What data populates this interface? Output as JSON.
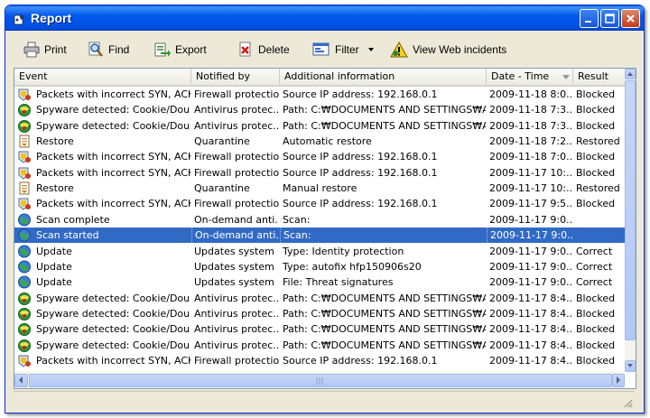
{
  "window": {
    "title": "Report"
  },
  "toolbar": {
    "print": "Print",
    "find": "Find",
    "export": "Export",
    "delete": "Delete",
    "filter": "Filter",
    "view_web": "View Web incidents"
  },
  "columns": [
    "Event",
    "Notified by",
    "Additional information",
    "Date - Time",
    "Result"
  ],
  "rows": [
    {
      "icon": "shield",
      "event": "Packets with incorrect SYN, ACK...",
      "notified": "Firewall protection",
      "info": "Source IP address: 192.168.0.1",
      "date": "2009-11-18 8:0...",
      "result": "Blocked"
    },
    {
      "icon": "spyware",
      "event": "Spyware detected: Cookie/Dou...",
      "notified": "Antivirus protec...",
      "info": "Path: C:₩DOCUMENTS AND SETTINGS₩AD...",
      "date": "2009-11-18 7:3...",
      "result": "Blocked"
    },
    {
      "icon": "spyware",
      "event": "Spyware detected: Cookie/Dou...",
      "notified": "Antivirus protec...",
      "info": "Path: C:₩DOCUMENTS AND SETTINGS₩AD...",
      "date": "2009-11-18 7:3...",
      "result": "Blocked"
    },
    {
      "icon": "restore",
      "event": "Restore",
      "notified": "Quarantine",
      "info": "Automatic restore",
      "date": "2009-11-18 7:2...",
      "result": "Restored"
    },
    {
      "icon": "shield",
      "event": "Packets with incorrect SYN, ACK...",
      "notified": "Firewall protection",
      "info": "Source IP address: 192.168.0.1",
      "date": "2009-11-18 7:0...",
      "result": "Blocked"
    },
    {
      "icon": "shield",
      "event": "Packets with incorrect SYN, ACK...",
      "notified": "Firewall protection",
      "info": "Source IP address: 192.168.0.1",
      "date": "2009-11-17 10:...",
      "result": "Blocked"
    },
    {
      "icon": "restore",
      "event": "Restore",
      "notified": "Quarantine",
      "info": "Manual restore",
      "date": "2009-11-17 10:...",
      "result": "Restored"
    },
    {
      "icon": "shield",
      "event": "Packets with incorrect SYN, ACK...",
      "notified": "Firewall protection",
      "info": "Source IP address: 192.168.0.1",
      "date": "2009-11-17 9:5...",
      "result": "Blocked"
    },
    {
      "icon": "globe",
      "event": "Scan complete",
      "notified": "On-demand anti...",
      "info": "Scan:",
      "date": "2009-11-17 9:0...",
      "result": ""
    },
    {
      "icon": "globe",
      "event": "Scan started",
      "notified": "On-demand anti...",
      "info": "Scan:",
      "date": "2009-11-17 9:0...",
      "result": "",
      "selected": true
    },
    {
      "icon": "globe",
      "event": "Update",
      "notified": "Updates system",
      "info": "Type: Identity protection",
      "date": "2009-11-17 9:0...",
      "result": "Correct"
    },
    {
      "icon": "globe",
      "event": "Update",
      "notified": "Updates system",
      "info": "Type: autofix hfp150906s20",
      "date": "2009-11-17 9:0...",
      "result": "Correct"
    },
    {
      "icon": "globe",
      "event": "Update",
      "notified": "Updates system",
      "info": "File: Threat signatures",
      "date": "2009-11-17 9:0...",
      "result": "Correct"
    },
    {
      "icon": "spyware",
      "event": "Spyware detected: Cookie/Dou...",
      "notified": "Antivirus protec...",
      "info": "Path: C:₩DOCUMENTS AND SETTINGS₩AD...",
      "date": "2009-11-17 8:4...",
      "result": "Blocked"
    },
    {
      "icon": "spyware",
      "event": "Spyware detected: Cookie/Dou...",
      "notified": "Antivirus protec...",
      "info": "Path: C:₩DOCUMENTS AND SETTINGS₩AD...",
      "date": "2009-11-17 8:4...",
      "result": "Blocked"
    },
    {
      "icon": "spyware",
      "event": "Spyware detected: Cookie/Dou...",
      "notified": "Antivirus protec...",
      "info": "Path: C:₩DOCUMENTS AND SETTINGS₩AD...",
      "date": "2009-11-17 8:4...",
      "result": "Blocked"
    },
    {
      "icon": "spyware",
      "event": "Spyware detected: Cookie/Dou...",
      "notified": "Antivirus protec...",
      "info": "Path: C:₩DOCUMENTS AND SETTINGS₩AD...",
      "date": "2009-11-17 8:4...",
      "result": "Blocked"
    },
    {
      "icon": "shield",
      "event": "Packets with incorrect SYN, ACK...",
      "notified": "Firewall protection",
      "info": "Source IP address: 192.168.0.1",
      "date": "2009-11-17 8:4...",
      "result": "Blocked"
    }
  ]
}
